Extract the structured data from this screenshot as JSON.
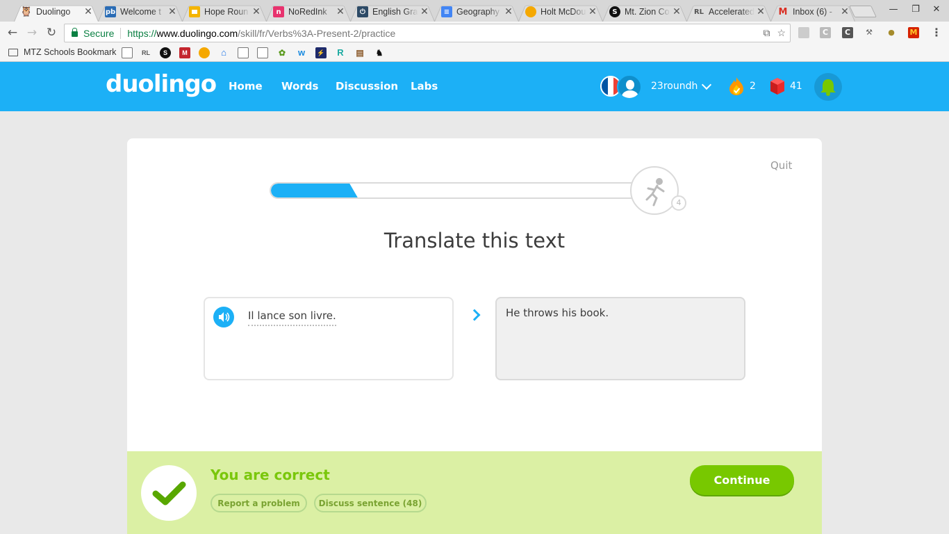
{
  "browser": {
    "tabs": [
      {
        "title": "Duolingo",
        "icon": "duolingo-owl-icon",
        "active": true
      },
      {
        "title": "Welcome t",
        "icon": "pb-icon"
      },
      {
        "title": "Hope Roun",
        "icon": "slides-icon"
      },
      {
        "title": "NoRedInk",
        "icon": "noredink-icon"
      },
      {
        "title": "English Gra",
        "icon": "power-icon"
      },
      {
        "title": "Geography",
        "icon": "docs-icon"
      },
      {
        "title": "Holt McDou",
        "icon": "orange-dot-icon"
      },
      {
        "title": "Mt. Zion Co",
        "icon": "s-logo-icon"
      },
      {
        "title": "Accelerated",
        "icon": "rl-icon"
      },
      {
        "title": "Inbox (6) -",
        "icon": "gmail-icon"
      }
    ],
    "address": {
      "secure_label": "Secure",
      "url_protocol": "https://",
      "url_host": "www.duolingo.com",
      "url_path": "/skill/fr/Verbs%3A-Present-2/practice"
    },
    "bookmarks": {
      "folder_label": "MTZ Schools Bookmark"
    }
  },
  "header": {
    "logo": "duolingo",
    "nav": [
      {
        "label": "Home"
      },
      {
        "label": "Words"
      },
      {
        "label": "Discussion"
      },
      {
        "label": "Labs"
      }
    ],
    "username": "23roundh",
    "streak": "2",
    "lingots": "41",
    "colors": {
      "brand": "#1cb0f6",
      "correct": "#7ac70c"
    }
  },
  "lesson": {
    "quit_label": "Quit",
    "progress_fraction": 0.2,
    "goal_count": "4",
    "prompt_title": "Translate this text",
    "source_sentence": "Il lance son livre.",
    "answer_text": "He throws his book."
  },
  "footer": {
    "result": "You are correct",
    "report_label": "Report a problem",
    "discuss_label": "Discuss sentence (48)",
    "continue_label": "Continue"
  }
}
